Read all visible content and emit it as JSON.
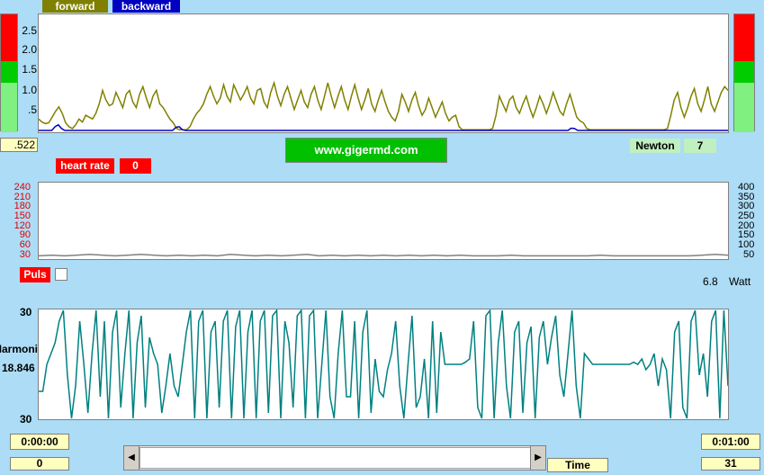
{
  "legend": {
    "forward": "forward",
    "backward": "backward"
  },
  "force_chart": {
    "ticks": [
      "2.5",
      "2.0",
      "1.5",
      "1.0",
      ".5"
    ],
    "current_value": ".522",
    "forward_y": [
      0.3,
      0.22,
      0.18,
      0.2,
      0.35,
      0.5,
      0.62,
      0.45,
      0.2,
      0.1,
      0.05,
      0.15,
      0.3,
      0.22,
      0.4,
      0.35,
      0.3,
      0.45,
      0.7,
      1.05,
      0.8,
      0.65,
      0.7,
      1.0,
      0.8,
      0.6,
      0.95,
      1.05,
      0.75,
      0.6,
      0.95,
      1.15,
      0.85,
      0.6,
      0.9,
      1.05,
      0.7,
      0.6,
      0.45,
      0.3,
      0.2,
      0.05,
      0.02,
      0.02,
      0.02,
      0.1,
      0.3,
      0.45,
      0.55,
      0.7,
      0.95,
      1.15,
      0.9,
      0.7,
      0.85,
      1.2,
      0.9,
      0.75,
      1.2,
      1.0,
      0.8,
      0.95,
      1.15,
      0.85,
      0.7,
      1.05,
      1.1,
      0.75,
      0.6,
      1.0,
      1.25,
      0.9,
      0.65,
      0.95,
      1.15,
      0.85,
      0.55,
      0.8,
      1.05,
      0.75,
      0.6,
      0.95,
      1.15,
      0.8,
      0.55,
      0.9,
      1.25,
      0.9,
      0.6,
      0.9,
      1.15,
      0.8,
      0.55,
      0.9,
      1.2,
      0.85,
      0.55,
      0.8,
      1.1,
      0.7,
      0.5,
      0.8,
      1.05,
      0.75,
      0.5,
      0.35,
      0.25,
      0.5,
      0.95,
      0.75,
      0.5,
      0.8,
      1.0,
      0.65,
      0.4,
      0.55,
      0.85,
      0.6,
      0.35,
      0.55,
      0.75,
      0.45,
      0.25,
      0.35,
      0.4,
      0.1,
      0.02,
      0.02,
      0.02,
      0.02,
      0.02,
      0.02,
      0.02,
      0.02,
      0.02,
      0.05,
      0.4,
      0.9,
      0.7,
      0.5,
      0.8,
      0.9,
      0.6,
      0.45,
      0.7,
      0.9,
      0.6,
      0.35,
      0.6,
      0.9,
      0.7,
      0.45,
      0.7,
      1.0,
      0.75,
      0.5,
      0.4,
      0.7,
      0.95,
      0.65,
      0.35,
      0.25,
      0.2,
      0.05,
      0.02,
      0.02,
      0.02,
      0.02,
      0.02,
      0.02,
      0.02,
      0.02,
      0.02,
      0.02,
      0.02,
      0.02,
      0.02,
      0.02,
      0.02,
      0.02,
      0.02,
      0.02,
      0.02,
      0.02,
      0.02,
      0.02,
      0.02,
      0.05,
      0.4,
      0.8,
      1.0,
      0.6,
      0.35,
      0.6,
      0.9,
      1.1,
      0.7,
      0.5,
      0.8,
      1.15,
      0.7,
      0.5,
      0.75,
      1.0,
      1.15,
      1.05
    ],
    "backward_y": [
      0,
      0,
      0,
      0,
      0,
      0.1,
      0.15,
      0.05,
      0,
      0,
      0,
      0,
      0,
      0,
      0,
      0,
      0,
      0,
      0,
      0,
      0,
      0,
      0,
      0,
      0,
      0,
      0,
      0,
      0,
      0,
      0,
      0,
      0,
      0,
      0,
      0,
      0,
      0,
      0,
      0,
      0,
      0,
      0.08,
      0.1,
      0.02,
      0,
      0,
      0,
      0,
      0,
      0,
      0,
      0,
      0,
      0,
      0,
      0,
      0,
      0,
      0,
      0,
      0,
      0,
      0,
      0,
      0,
      0,
      0,
      0,
      0,
      0,
      0,
      0,
      0,
      0,
      0,
      0,
      0,
      0,
      0,
      0,
      0,
      0,
      0,
      0,
      0,
      0,
      0,
      0,
      0,
      0,
      0,
      0,
      0,
      0,
      0,
      0,
      0,
      0,
      0,
      0,
      0,
      0,
      0,
      0,
      0,
      0,
      0,
      0,
      0,
      0,
      0,
      0,
      0,
      0,
      0,
      0,
      0,
      0,
      0,
      0,
      0,
      0,
      0,
      0,
      0,
      0,
      0,
      0,
      0,
      0,
      0,
      0,
      0,
      0,
      0,
      0,
      0,
      0,
      0,
      0,
      0,
      0,
      0,
      0,
      0,
      0,
      0,
      0,
      0,
      0,
      0,
      0,
      0,
      0,
      0,
      0,
      0,
      0,
      0,
      0,
      0,
      0,
      0.06,
      0.05,
      0,
      0,
      0,
      0,
      0,
      0,
      0,
      0,
      0,
      0,
      0,
      0,
      0,
      0,
      0,
      0,
      0,
      0,
      0,
      0,
      0,
      0,
      0,
      0,
      0,
      0,
      0,
      0,
      0,
      0,
      0,
      0,
      0,
      0,
      0,
      0,
      0,
      0,
      0,
      0,
      0,
      0,
      0,
      0,
      0,
      0,
      0
    ]
  },
  "website": "www.gigermd.com",
  "newton": {
    "label": "Newton",
    "value": "7"
  },
  "heart_rate": {
    "label": "heart rate",
    "value": "0"
  },
  "hr_chart": {
    "left_ticks": [
      "240",
      "210",
      "180",
      "150",
      "120",
      "90",
      "60",
      "30"
    ],
    "right_ticks": [
      "400",
      "350",
      "300",
      "250",
      "200",
      "150",
      "100",
      "50"
    ],
    "series_y": [
      0.02,
      0.03,
      0.02,
      0.03,
      0.04,
      0.03,
      0.02,
      0.03,
      0.04,
      0.03,
      0.02,
      0.03,
      0.02,
      0.03,
      0.02,
      0.04,
      0.03,
      0.02,
      0.03,
      0.02,
      0.03,
      0.04,
      0.02,
      0.03,
      0.02,
      0.03,
      0.02,
      0.03,
      0.02,
      0.03,
      0.02,
      0.03,
      0.02,
      0.03,
      0.02,
      0.02,
      0.02,
      0.03,
      0.02,
      0.02,
      0.02,
      0.02,
      0.02,
      0.02,
      0.03,
      0.02,
      0.02,
      0.02,
      0.02,
      0.02,
      0.02,
      0.02,
      0.03,
      0.04,
      0.03
    ]
  },
  "puls": {
    "label": "Puls"
  },
  "watt": {
    "value": "6.8",
    "unit": "Watt"
  },
  "harmony_chart": {
    "top_label": "30",
    "bottom_label": "30",
    "side_label": "Harmoni",
    "value": "18.846",
    "series_y": [
      0.25,
      0.25,
      0.5,
      0.6,
      0.7,
      0.9,
      1.0,
      0.4,
      0.0,
      0.3,
      0.9,
      0.5,
      0.05,
      0.6,
      1.0,
      0.2,
      0.9,
      0.0,
      0.8,
      1.0,
      0.1,
      0.6,
      1.0,
      0.0,
      0.7,
      0.95,
      0.1,
      0.75,
      0.6,
      0.5,
      0.05,
      0.3,
      0.6,
      0.3,
      0.2,
      0.5,
      0.8,
      1.0,
      0.0,
      0.9,
      1.0,
      0.0,
      0.8,
      0.9,
      0.1,
      0.9,
      1.0,
      0.0,
      0.85,
      1.0,
      0.0,
      0.8,
      1.0,
      0.0,
      0.9,
      1.0,
      0.05,
      0.95,
      1.0,
      0.0,
      0.9,
      0.7,
      0.1,
      0.95,
      1.0,
      0.0,
      0.95,
      1.0,
      0.0,
      0.5,
      1.0,
      0.2,
      0.0,
      0.6,
      1.0,
      0.2,
      0.2,
      0.9,
      0.0,
      0.8,
      1.0,
      0.05,
      0.55,
      0.25,
      0.2,
      0.45,
      0.6,
      0.9,
      0.3,
      0.0,
      0.5,
      0.95,
      0.1,
      0.2,
      0.55,
      0.0,
      0.9,
      0.05,
      0.8,
      0.5,
      0.5,
      0.5,
      0.5,
      0.5,
      0.52,
      0.55,
      0.9,
      0.1,
      0.0,
      0.95,
      1.0,
      0.0,
      0.7,
      1.0,
      0.3,
      0.0,
      0.8,
      0.9,
      0.05,
      0.7,
      0.85,
      0.0,
      0.75,
      0.9,
      0.5,
      0.75,
      0.95,
      0.4,
      0.2,
      0.6,
      1.0,
      0.3,
      0.0,
      0.6,
      0.55,
      0.5,
      0.5,
      0.5,
      0.5,
      0.5,
      0.5,
      0.5,
      0.5,
      0.5,
      0.5,
      0.52,
      0.5,
      0.55,
      0.45,
      0.5,
      0.6,
      0.3,
      0.55,
      0.45,
      0.0,
      0.8,
      0.9,
      0.1,
      0.0,
      0.9,
      1.0,
      0.4,
      0.6,
      0.2,
      0.9,
      1.0,
      0.0,
      1.0,
      0.3
    ]
  },
  "time": {
    "start": "0:00:00",
    "start_count": "0",
    "end": "0:01:00",
    "end_count": "31",
    "label": "Time"
  },
  "colors": {
    "forward": "#808000",
    "backward": "#0000c0",
    "harmony": "#008080",
    "hr": "#808080",
    "red": "#ff0000",
    "green": "#00cc00"
  }
}
